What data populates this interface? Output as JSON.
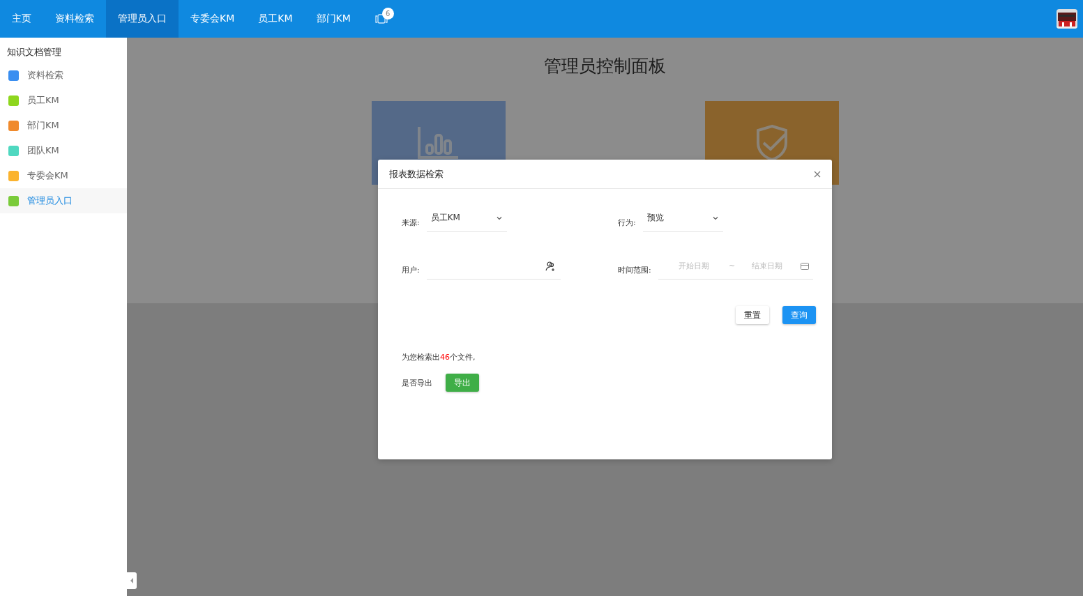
{
  "nav": {
    "items": [
      {
        "label": "主页",
        "selected": false
      },
      {
        "label": "资料检索",
        "selected": false
      },
      {
        "label": "管理员入口",
        "selected": true
      },
      {
        "label": "专委会KM",
        "selected": false
      },
      {
        "label": "员工KM",
        "selected": false
      },
      {
        "label": "部门KM",
        "selected": false
      }
    ],
    "badge": "6"
  },
  "sidebar": {
    "title": "知识文档管理",
    "items": [
      {
        "label": "资料检索",
        "color": "#3a8ef0",
        "selected": false
      },
      {
        "label": "员工KM",
        "color": "#8ed61e",
        "selected": false
      },
      {
        "label": "部门KM",
        "color": "#f08a2c",
        "selected": false
      },
      {
        "label": "团队KM",
        "color": "#4fd8c0",
        "selected": false
      },
      {
        "label": "专委会KM",
        "color": "#fbb32e",
        "selected": false
      },
      {
        "label": "管理员入口",
        "color": "#7acb3a",
        "selected": true
      }
    ]
  },
  "dashboard": {
    "title": "管理员控制面板",
    "tiles": [
      {
        "kind": "chart"
      },
      {
        "kind": "shield"
      }
    ]
  },
  "dialog": {
    "title": "报表数据检索",
    "source": {
      "label": "来源:",
      "value": "员工KM"
    },
    "action": {
      "label": "行为:",
      "value": "预览"
    },
    "user": {
      "label": "用户:"
    },
    "time_range": {
      "label": "时间范围:",
      "start_placeholder": "开始日期",
      "separator": "~",
      "end_placeholder": "结束日期"
    },
    "buttons": [
      {
        "kind": "plain",
        "label": "重置"
      },
      {
        "kind": "primary",
        "label": "查询"
      }
    ],
    "result": {
      "prefix": "为您检索出",
      "count": "46",
      "suffix": "个文件,"
    },
    "export": {
      "label": "是否导出",
      "button": "导出"
    }
  }
}
